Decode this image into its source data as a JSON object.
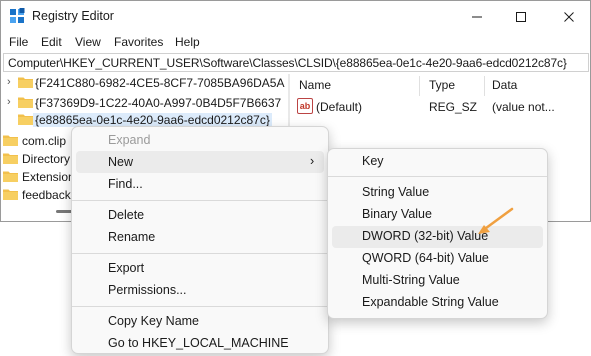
{
  "window": {
    "title": "Registry Editor",
    "controls": {
      "minimize": "—",
      "maximize": "☐",
      "close": "✕"
    }
  },
  "menubar": [
    "File",
    "Edit",
    "View",
    "Favorites",
    "Help"
  ],
  "address": "Computer\\HKEY_CURRENT_USER\\Software\\Classes\\CLSID\\{e88865ea-0e1c-4e20-9aa6-edcd0212c87c}",
  "tree": [
    {
      "label": "{F241C880-6982-4CE5-8CF7-7085BA96DA5A",
      "chevron": "›"
    },
    {
      "label": "{F37369D9-1C22-40A0-A997-0B4D5F7B6637",
      "chevron": "›"
    },
    {
      "label": "{e88865ea-0e1c-4e20-9aa6-edcd0212c87c}",
      "selected": true
    },
    {
      "label": "com.clip"
    },
    {
      "label": "Directory"
    },
    {
      "label": "Extension"
    },
    {
      "label": "feedback"
    }
  ],
  "values_pane": {
    "headers": [
      "Name",
      "Type",
      "Data"
    ],
    "rows": [
      {
        "icon": "ab",
        "name": "(Default)",
        "type": "REG_SZ",
        "data": "(value not..."
      }
    ]
  },
  "context_menu": {
    "items": [
      "Expand",
      "New",
      "Find...",
      "Delete",
      "Rename",
      "Export",
      "Permissions...",
      "Copy Key Name",
      "Go to HKEY_LOCAL_MACHINE"
    ],
    "new_arrow": "›"
  },
  "submenu": {
    "items": [
      "Key",
      "String Value",
      "Binary Value",
      "DWORD (32-bit) Value",
      "QWORD (64-bit) Value",
      "Multi-String Value",
      "Expandable String Value"
    ],
    "highlighted": "DWORD (32-bit) Value"
  },
  "watermark": "top-password.com",
  "colors": {
    "folder": "#f2c04c",
    "selection": "#dcebfb",
    "arrow": "#f0a040",
    "icon_blue": "#1a73c8"
  }
}
